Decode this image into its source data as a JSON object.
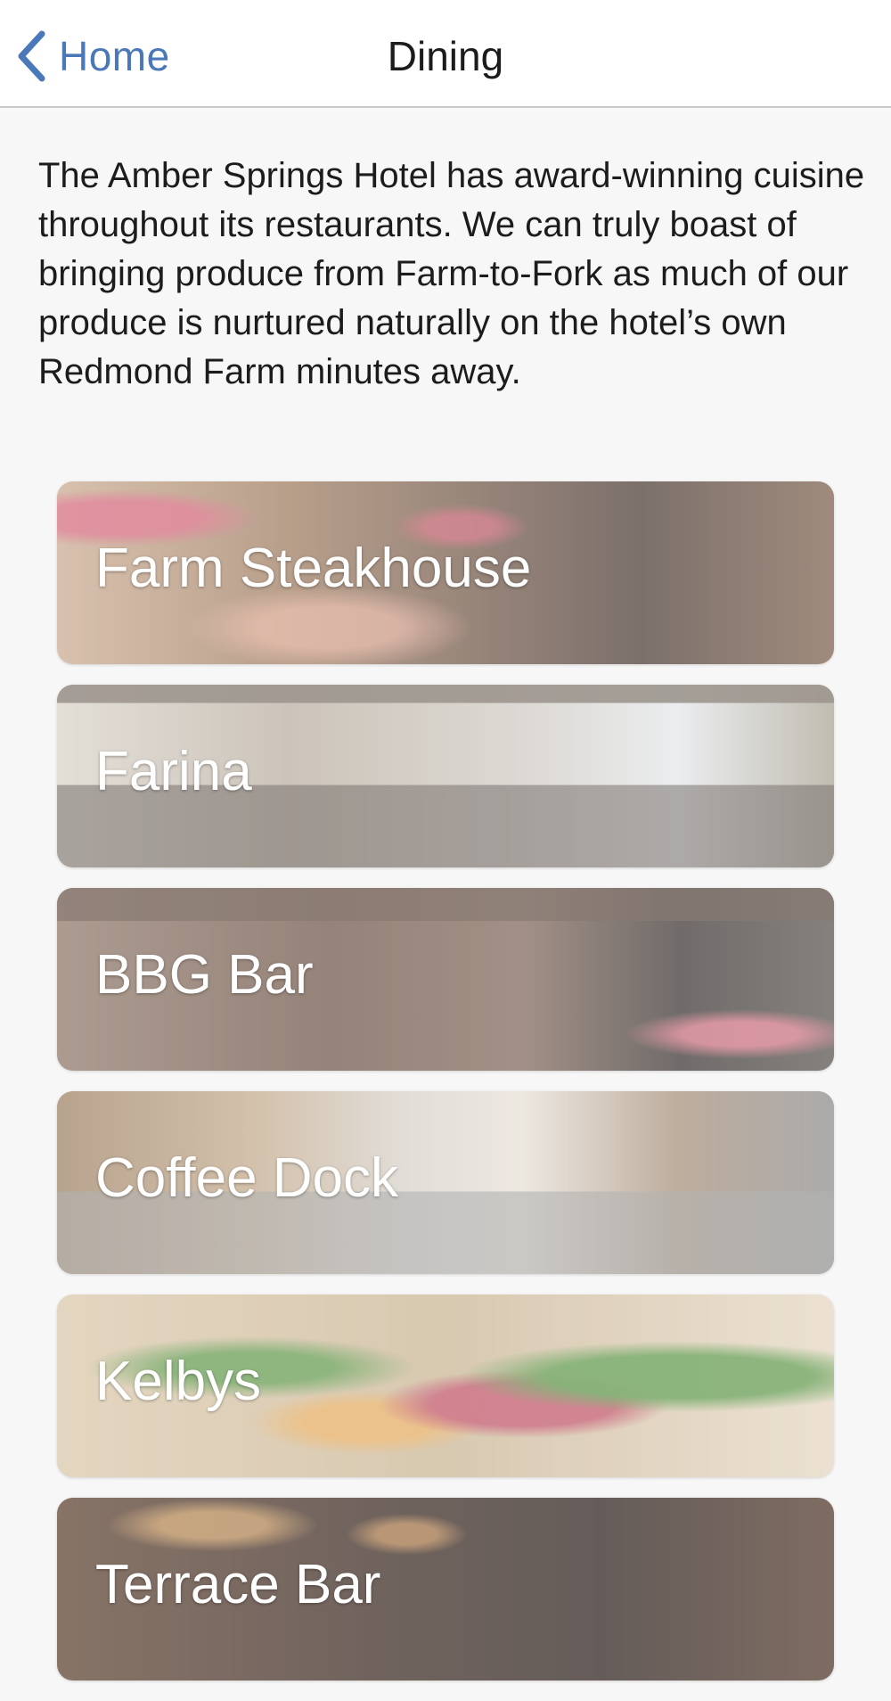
{
  "nav": {
    "back_label": "Home",
    "title": "Dining"
  },
  "intro": "The Amber Springs Hotel has award-winning cuisine throughout its restaurants. We can truly boast of bringing produce from Farm-to-Fork as much of our produce is nurtured naturally on the hotel’s own Redmond Farm minutes away.",
  "restaurants": [
    {
      "label": "Farm Steakhouse"
    },
    {
      "label": "Farina"
    },
    {
      "label": "BBG Bar"
    },
    {
      "label": "Coffee Dock"
    },
    {
      "label": "Kelbys"
    },
    {
      "label": "Terrace Bar"
    }
  ],
  "colors": {
    "accent": "#4a78b8",
    "background": "#f7f7f7",
    "nav_background": "#ffffff",
    "text": "#1c1c1e"
  }
}
